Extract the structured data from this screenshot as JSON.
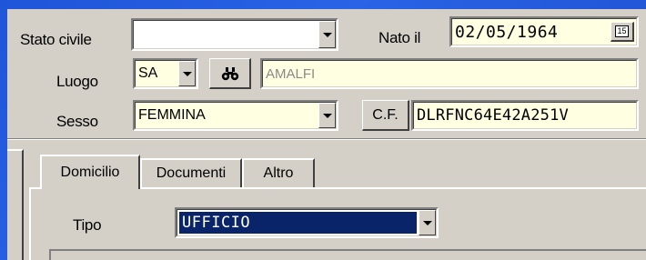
{
  "form": {
    "stato_civile": {
      "label": "Stato civile",
      "value": ""
    },
    "nato_il": {
      "label": "Nato il",
      "value": "02/05/1964",
      "calendar_icon_text": "15"
    },
    "luogo": {
      "label": "Luogo",
      "province": "SA",
      "city": "AMALFI"
    },
    "sesso": {
      "label": "Sesso",
      "value": "FEMMINA"
    },
    "cf": {
      "button_label": "C.F.",
      "value": "DLRFNC64E42A251V"
    }
  },
  "tabs": [
    {
      "label": "Domicilio",
      "active": true
    },
    {
      "label": "Documenti",
      "active": false
    },
    {
      "label": "Altro",
      "active": false
    }
  ],
  "domicilio": {
    "tipo": {
      "label": "Tipo",
      "value": "UFFICIO"
    }
  },
  "colors": {
    "background_blue": "#2a63e6",
    "panel_gray": "#d4d0c8",
    "field_yellow": "#ffffe1",
    "selection_navy": "#0a246a"
  }
}
